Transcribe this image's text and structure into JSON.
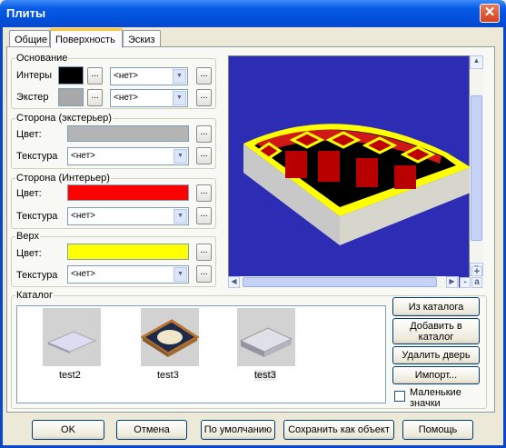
{
  "window": {
    "title": "Плиты",
    "close_glyph": "✕"
  },
  "tabs": [
    {
      "label": "Общие"
    },
    {
      "label": "Поверхность"
    },
    {
      "label": "Эскиз"
    }
  ],
  "base": {
    "legend": "Основание",
    "interior_label": "Интеры",
    "exterior_label": "Экстер",
    "interior_color": "#000000",
    "exterior_color": "#a8a8a8",
    "interior_value": "<нет>",
    "exterior_value": "<нет>"
  },
  "side_ext": {
    "legend": "Сторона (экстерьер)",
    "color_label": "Цвет:",
    "texture_label": "Текстура",
    "color": "#b4b4b4",
    "texture_value": "<нет>"
  },
  "side_int": {
    "legend": "Сторона (Интерьер)",
    "color_label": "Цвет:",
    "texture_label": "Текстура",
    "color": "#ff0000",
    "texture_value": "<нет>"
  },
  "top": {
    "legend": "Верх",
    "color_label": "Цвет:",
    "texture_label": "Текстура",
    "color": "#ffff00",
    "texture_value": "<нет>"
  },
  "ellipsis": "...",
  "preview": {
    "background": "#2c2cb4",
    "zoom_in": "+",
    "zoom_out": "-",
    "auto": "a"
  },
  "catalog": {
    "legend": "Каталог",
    "items": [
      {
        "name": "test2"
      },
      {
        "name": "test3"
      },
      {
        "name": "test3"
      }
    ],
    "from_catalog": "Из каталога",
    "add_to_catalog": "Добавить в каталог",
    "delete_door": "Удалить дверь",
    "import": "Импорт...",
    "small_icons": "Маленькие значки"
  },
  "footer": {
    "ok": "OK",
    "cancel": "Отмена",
    "default": "По умолчанию",
    "save_as_object": "Сохранить как объект",
    "help": "Помощь"
  }
}
